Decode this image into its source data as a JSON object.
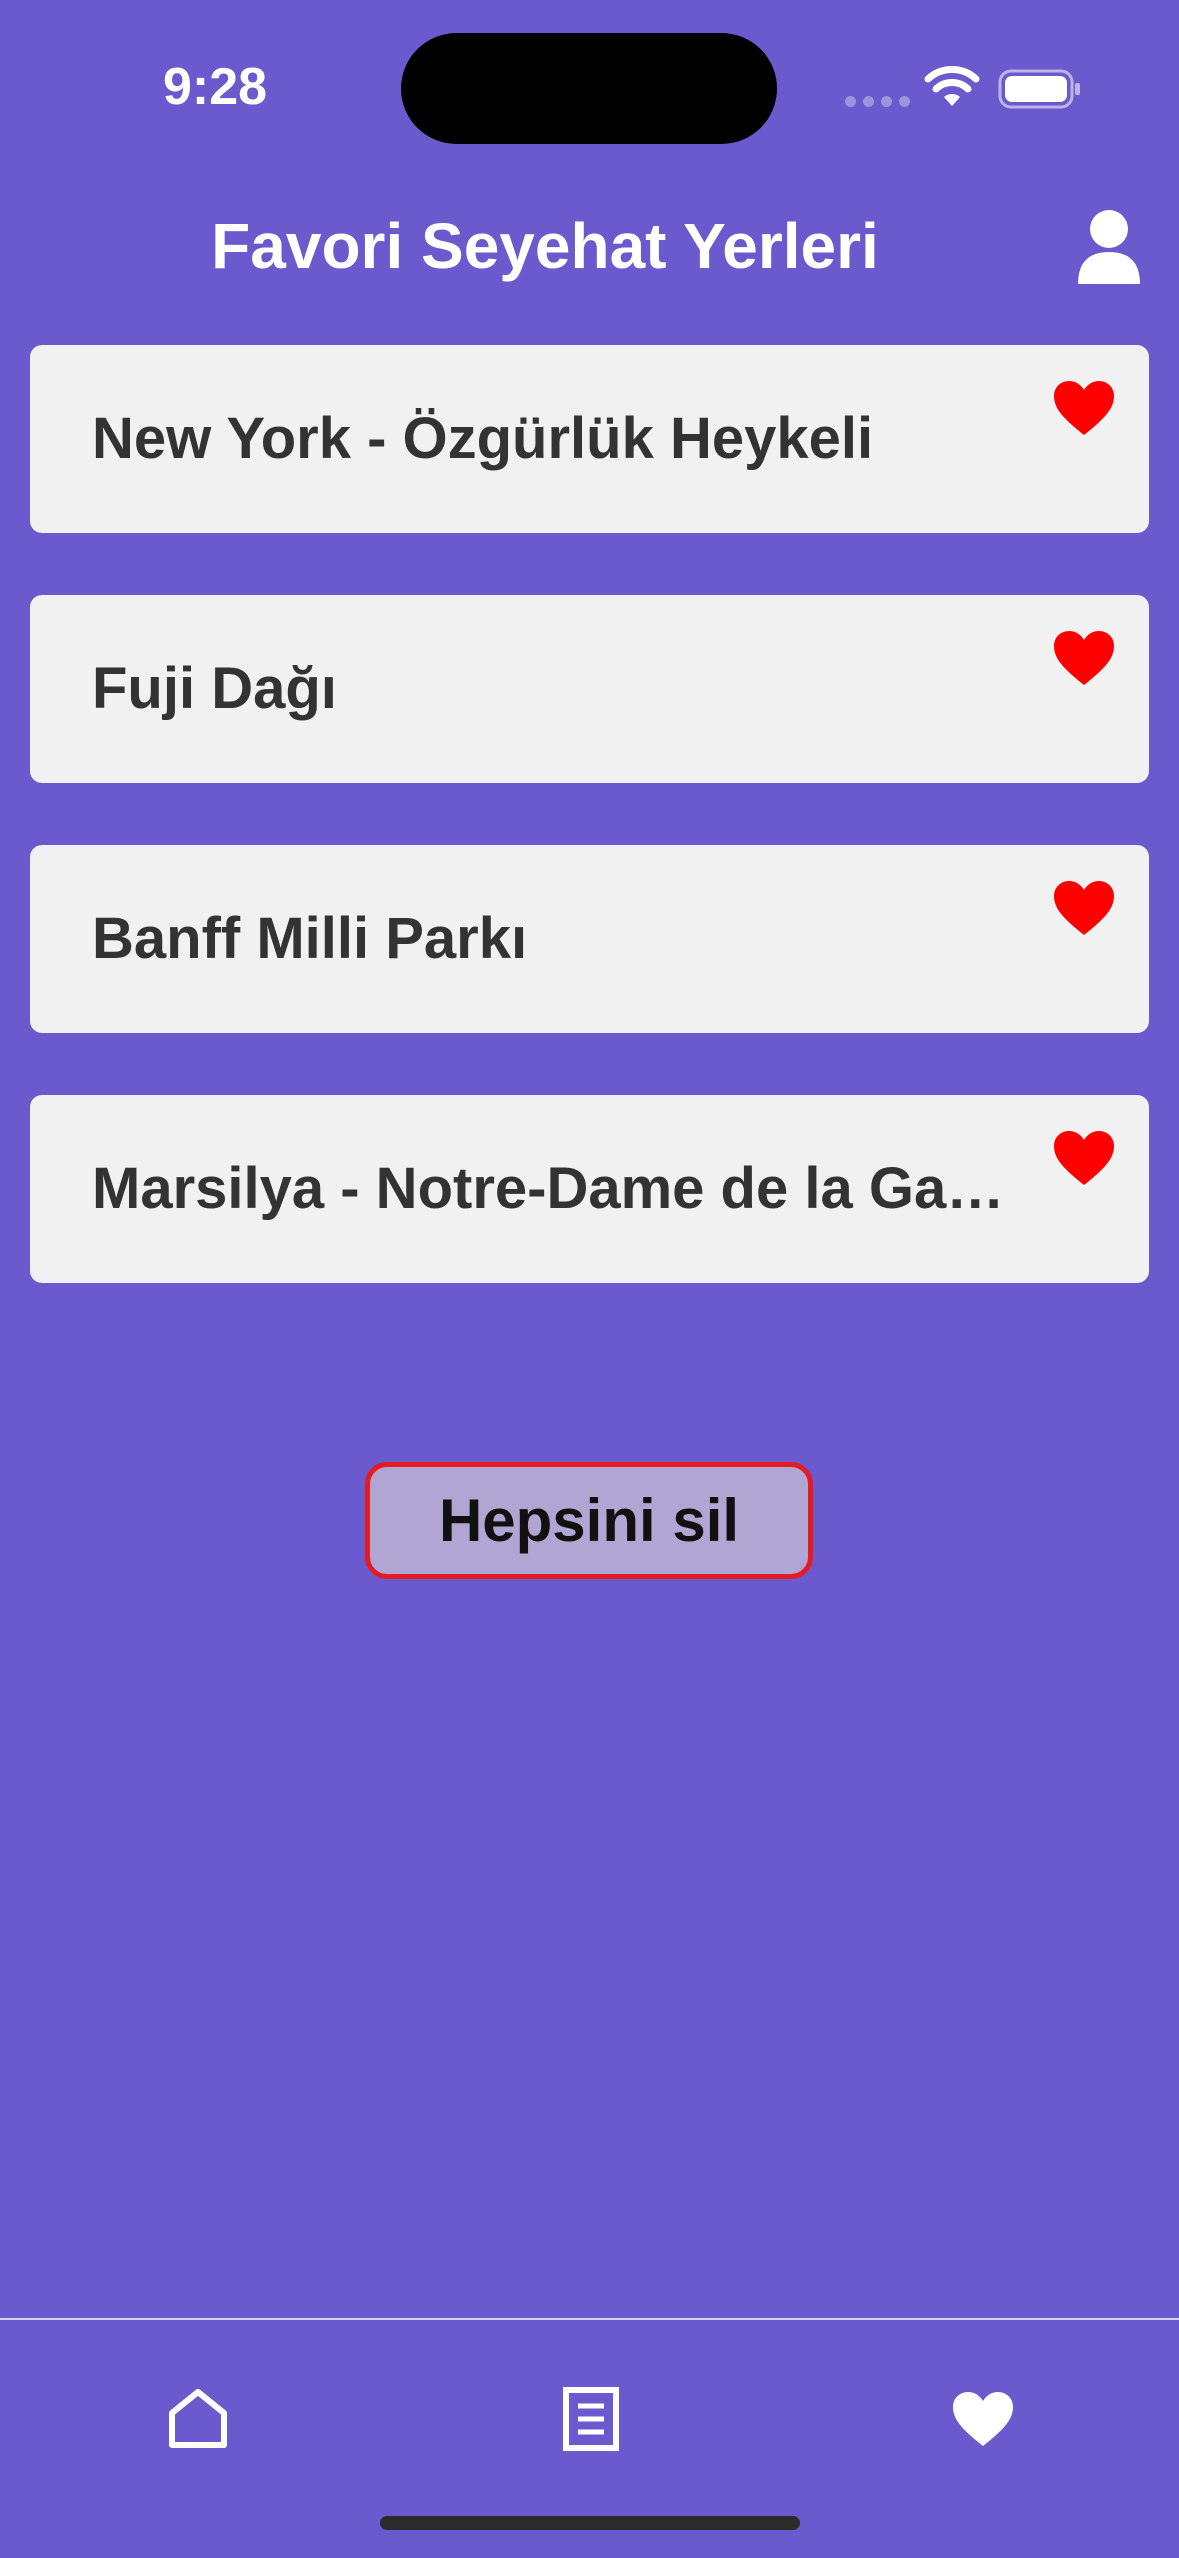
{
  "status_bar": {
    "time": "9:28",
    "icons": [
      "cellular-signal-icon",
      "wifi-icon",
      "battery-icon"
    ]
  },
  "header": {
    "title": "Favori Seyehat Yerleri",
    "profile_icon": "user-icon"
  },
  "favorites": [
    {
      "title": "New York - Özgürlük Heykeli",
      "icon": "heart-icon"
    },
    {
      "title": "Fuji Dağı",
      "icon": "heart-icon"
    },
    {
      "title": "Banff Milli Parkı",
      "icon": "heart-icon"
    },
    {
      "title": "Marsilya - Notre-Dame de la Garde",
      "icon": "heart-icon"
    }
  ],
  "delete_all_label": "Hepsini sil",
  "tab_bar": {
    "tabs": [
      {
        "icon": "home-icon"
      },
      {
        "icon": "document-list-icon"
      },
      {
        "icon": "heart-icon"
      }
    ]
  },
  "colors": {
    "background": "#6a5acd",
    "card": "#f1f1f1",
    "card_text": "#333333",
    "heart": "#ff0000",
    "button_fill": "#b1a6d3",
    "button_border": "#e31b23"
  }
}
